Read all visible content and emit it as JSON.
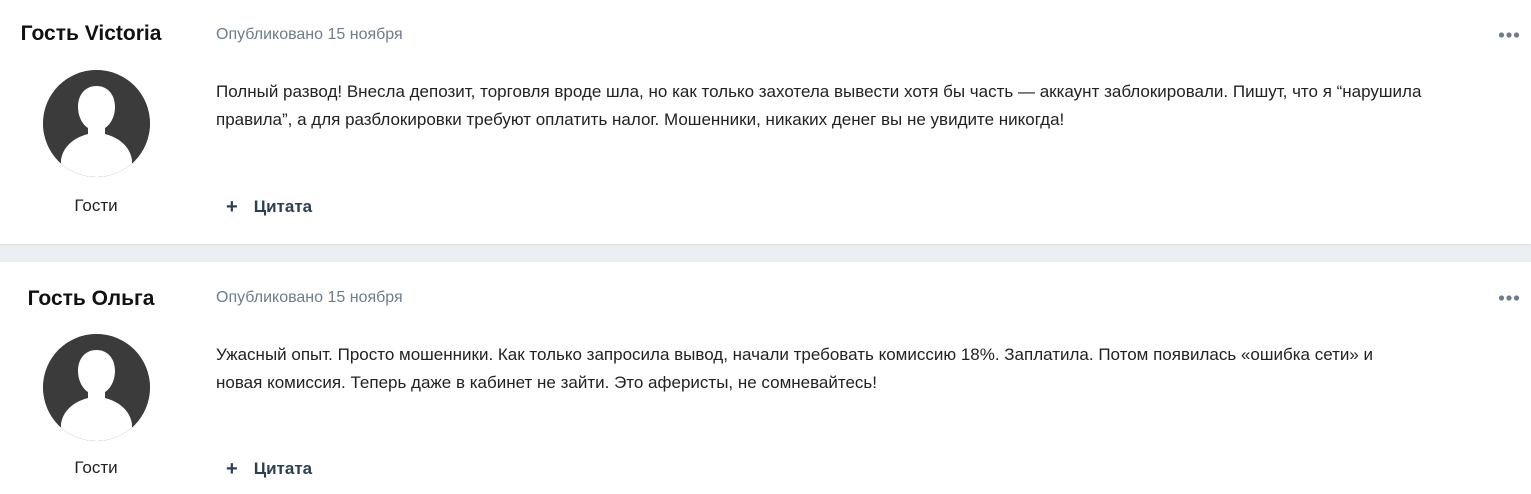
{
  "posts": [
    {
      "author": "Гость Victoria",
      "group": "Гости",
      "date": "Опубликовано 15 ноября",
      "body_lines": [
        "Полный развод! Внесла депозит, торговля вроде шла, но как только захотела вывести хотя бы часть — аккаунт заблокировали. Пишут, что я “нарушила",
        "правила”, а для разблокировки требуют оплатить налог. Мошенники, никаких денег вы не увидите никогда!"
      ],
      "quote_label": "Цитата",
      "more_icon": "ellipsis-icon"
    },
    {
      "author": "Гость Ольга",
      "group": "Гости",
      "date": "Опубликовано 15 ноября",
      "body_lines": [
        "Ужасный опыт. Просто мошенники. Как только запросила вывод, начали требовать комиссию 18%. Заплатила. Потом появилась «ошибка сети» и",
        "новая комиссия. Теперь даже в кабинет не зайти. Это аферисты, не сомневайтесь!"
      ],
      "quote_label": "Цитата",
      "more_icon": "ellipsis-icon"
    }
  ],
  "colors": {
    "page_background": "#ebeef2",
    "post_background": "#ffffff",
    "meta_text": "#6e7c8c",
    "quote_text": "#2b3f57",
    "avatar_fill": "#3b3b3b"
  }
}
